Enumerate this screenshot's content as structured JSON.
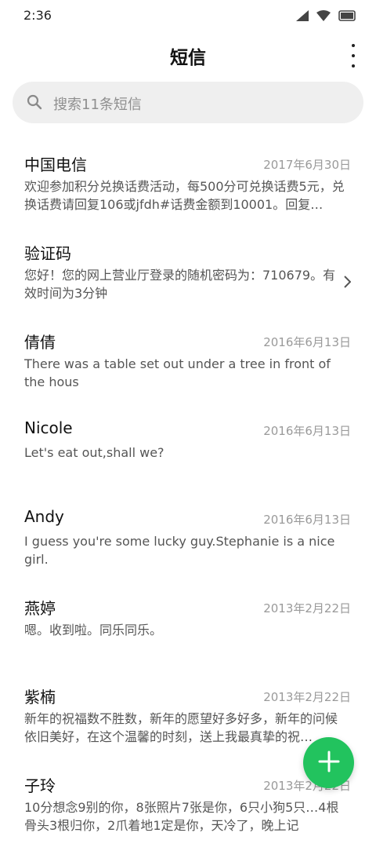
{
  "status_bar": {
    "time": "2:36"
  },
  "header": {
    "title": "短信"
  },
  "search": {
    "placeholder": "搜索11条短信"
  },
  "messages": [
    {
      "name": "中国电信",
      "date": "2017年6月30日",
      "preview": "欢迎参加积分兑换话费活动，每500分可兑换话费5元，兑换话费请回复106或jfdh#话费金额到10001。回复…"
    },
    {
      "name": "验证码",
      "date": "",
      "preview": "您好！您的网上营业厅登录的随机密码为：710679。有效时间为3分钟"
    },
    {
      "name": "倩倩",
      "date": "2016年6月13日",
      "preview": "There was a table set out under a tree in front of the hous"
    },
    {
      "name": "Nicole",
      "date": "2016年6月13日",
      "preview": "Let's eat out,shall we?"
    },
    {
      "name": "Andy",
      "date": "2016年6月13日",
      "preview": "I guess you're some lucky guy.Stephanie is a nice girl."
    },
    {
      "name": "燕婷",
      "date": "2013年2月22日",
      "preview": "嗯。收到啦。同乐同乐。"
    },
    {
      "name": "紫楠",
      "date": "2013年2月22日",
      "preview": "新年的祝福数不胜数，新年的愿望好多好多，新年的问候依旧美好，在这个温馨的时刻，送上我最真挚的祝…"
    },
    {
      "name": "子玲",
      "date": "2013年2月22日",
      "preview": "10分想念9别的你，8张照片7张是你，6只小狗5只…4根骨头3根归你，2爪着地1定是你，天冷了，晚上记"
    }
  ],
  "colors": {
    "accent": "#22c35e",
    "date": "#9a9a9a",
    "preview": "#555555",
    "search_bg": "#efefef"
  }
}
